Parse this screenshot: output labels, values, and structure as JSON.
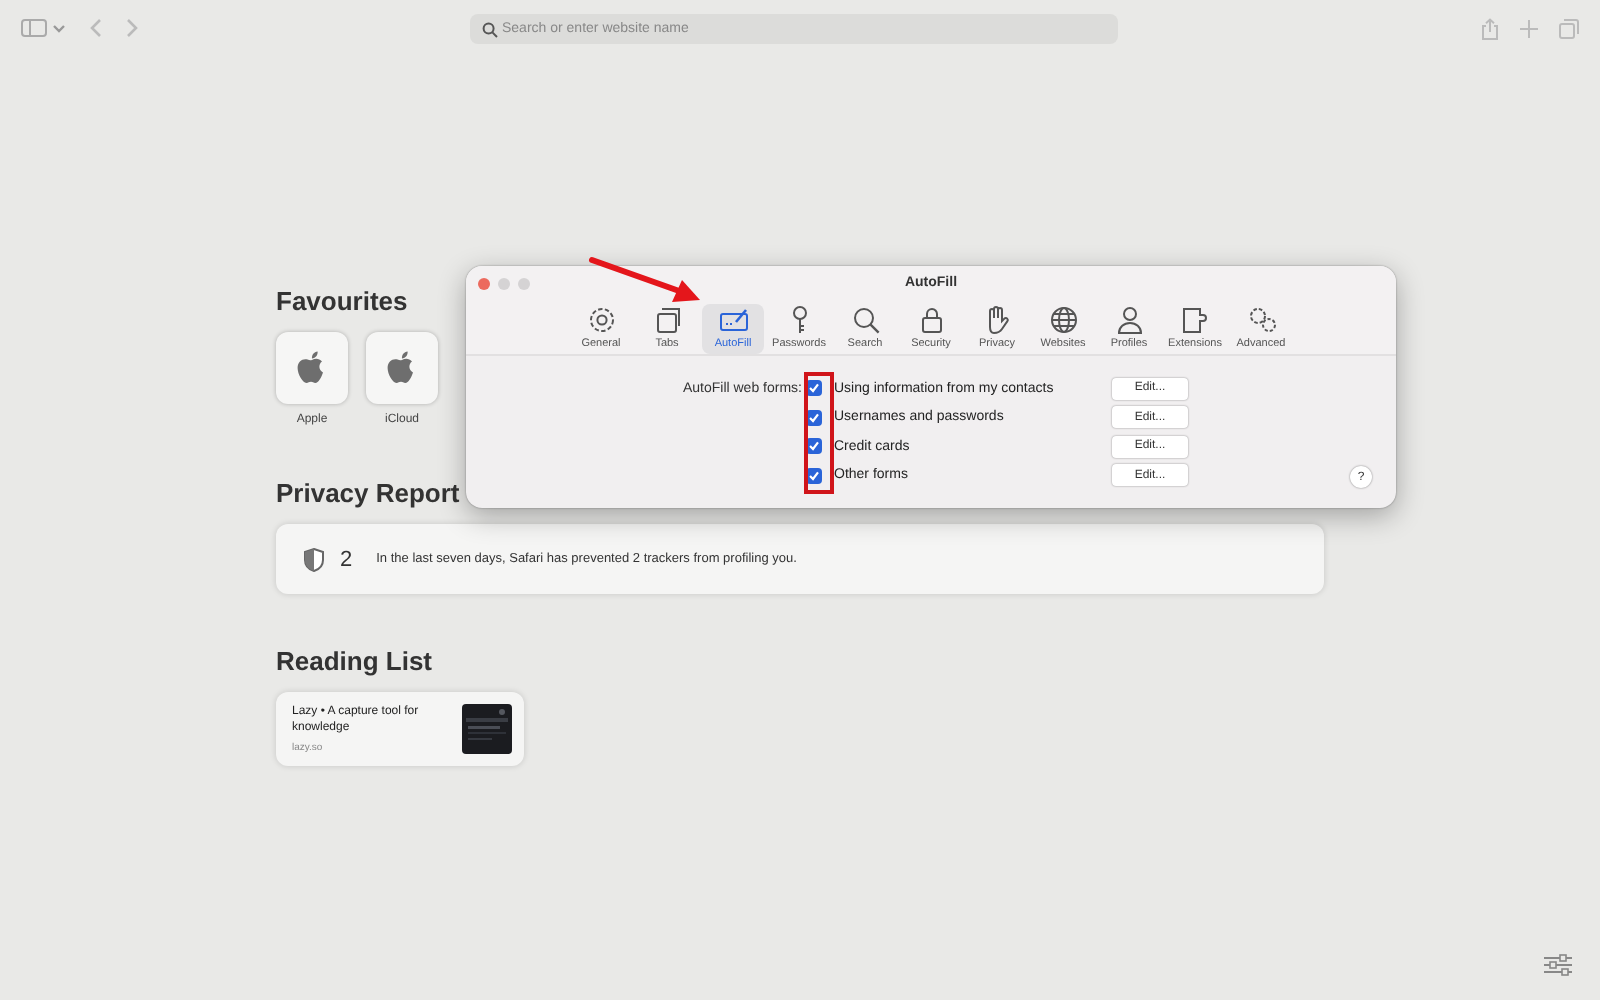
{
  "toolbar": {
    "search": {
      "placeholder": "Search or enter website name"
    }
  },
  "favourites": {
    "title": "Favourites",
    "items": [
      {
        "label": "Apple"
      },
      {
        "label": "iCloud"
      }
    ]
  },
  "privacy_report": {
    "title": "Privacy Report",
    "count": "2",
    "message": "In the last seven days, Safari has prevented 2 trackers from profiling you."
  },
  "reading_list": {
    "title": "Reading List",
    "items": [
      {
        "title": "Lazy • A capture tool for knowledge",
        "source": "lazy.so"
      }
    ]
  },
  "preferences": {
    "title": "AutoFill",
    "tabs": [
      {
        "label": "General",
        "selected": false
      },
      {
        "label": "Tabs",
        "selected": false
      },
      {
        "label": "AutoFill",
        "selected": true
      },
      {
        "label": "Passwords",
        "selected": false
      },
      {
        "label": "Search",
        "selected": false
      },
      {
        "label": "Security",
        "selected": false
      },
      {
        "label": "Privacy",
        "selected": false
      },
      {
        "label": "Websites",
        "selected": false
      },
      {
        "label": "Profiles",
        "selected": false
      },
      {
        "label": "Extensions",
        "selected": false
      },
      {
        "label": "Advanced",
        "selected": false
      }
    ],
    "form_label": "AutoFill web forms:",
    "rows": [
      {
        "label": "Using information from my contacts",
        "checked": true,
        "button": "Edit..."
      },
      {
        "label": "Usernames and passwords",
        "checked": true,
        "button": "Edit..."
      },
      {
        "label": "Credit cards",
        "checked": true,
        "button": "Edit..."
      },
      {
        "label": "Other forms",
        "checked": true,
        "button": "Edit..."
      }
    ],
    "help": "?"
  }
}
